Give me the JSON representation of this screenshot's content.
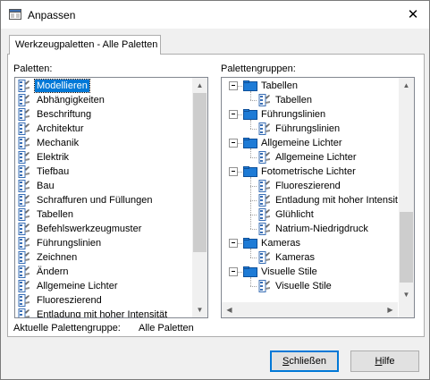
{
  "window": {
    "title": "Anpassen",
    "close_glyph": "✕"
  },
  "tab": {
    "label": "Werkzeugpaletten - Alle Paletten"
  },
  "palettes": {
    "label": "Paletten:",
    "items": [
      "Modellieren",
      "Abhängigkeiten",
      "Beschriftung",
      "Architektur",
      "Mechanik",
      "Elektrik",
      "Tiefbau",
      "Bau",
      "Schraffuren und Füllungen",
      "Tabellen",
      "Befehlswerkzeugmuster",
      "Führungslinien",
      "Zeichnen",
      "Ändern",
      "Allgemeine Lichter",
      "Fluoreszierend",
      "Entladung mit hoher Intensität"
    ],
    "selected_index": 0
  },
  "groups": {
    "label": "Palettengruppen:",
    "tree": [
      {
        "name": "Tabellen",
        "children": [
          "Tabellen"
        ]
      },
      {
        "name": "Führungslinien",
        "children": [
          "Führungslinien"
        ]
      },
      {
        "name": "Allgemeine Lichter",
        "children": [
          "Allgemeine Lichter"
        ]
      },
      {
        "name": "Fotometrische Lichter",
        "children": [
          "Fluoreszierend",
          "Entladung mit hoher Intensität",
          "Glühlicht",
          "Natrium-Niedrigdruck"
        ]
      },
      {
        "name": "Kameras",
        "children": [
          "Kameras"
        ]
      },
      {
        "name": "Visuelle Stile",
        "children": [
          "Visuelle Stile"
        ]
      }
    ]
  },
  "current_group": {
    "label": "Aktuelle Palettengruppe:",
    "value": "Alle Paletten"
  },
  "buttons": {
    "close": {
      "accel": "S",
      "rest": "chließen"
    },
    "help": {
      "accel": "H",
      "rest": "ilfe"
    }
  },
  "icons": {
    "app": "customize-app-icon",
    "palette": "tool-palette-icon",
    "group": "palette-group-folder-icon"
  },
  "colors": {
    "accent": "#0078d7",
    "folder": "#1e7bd6"
  }
}
